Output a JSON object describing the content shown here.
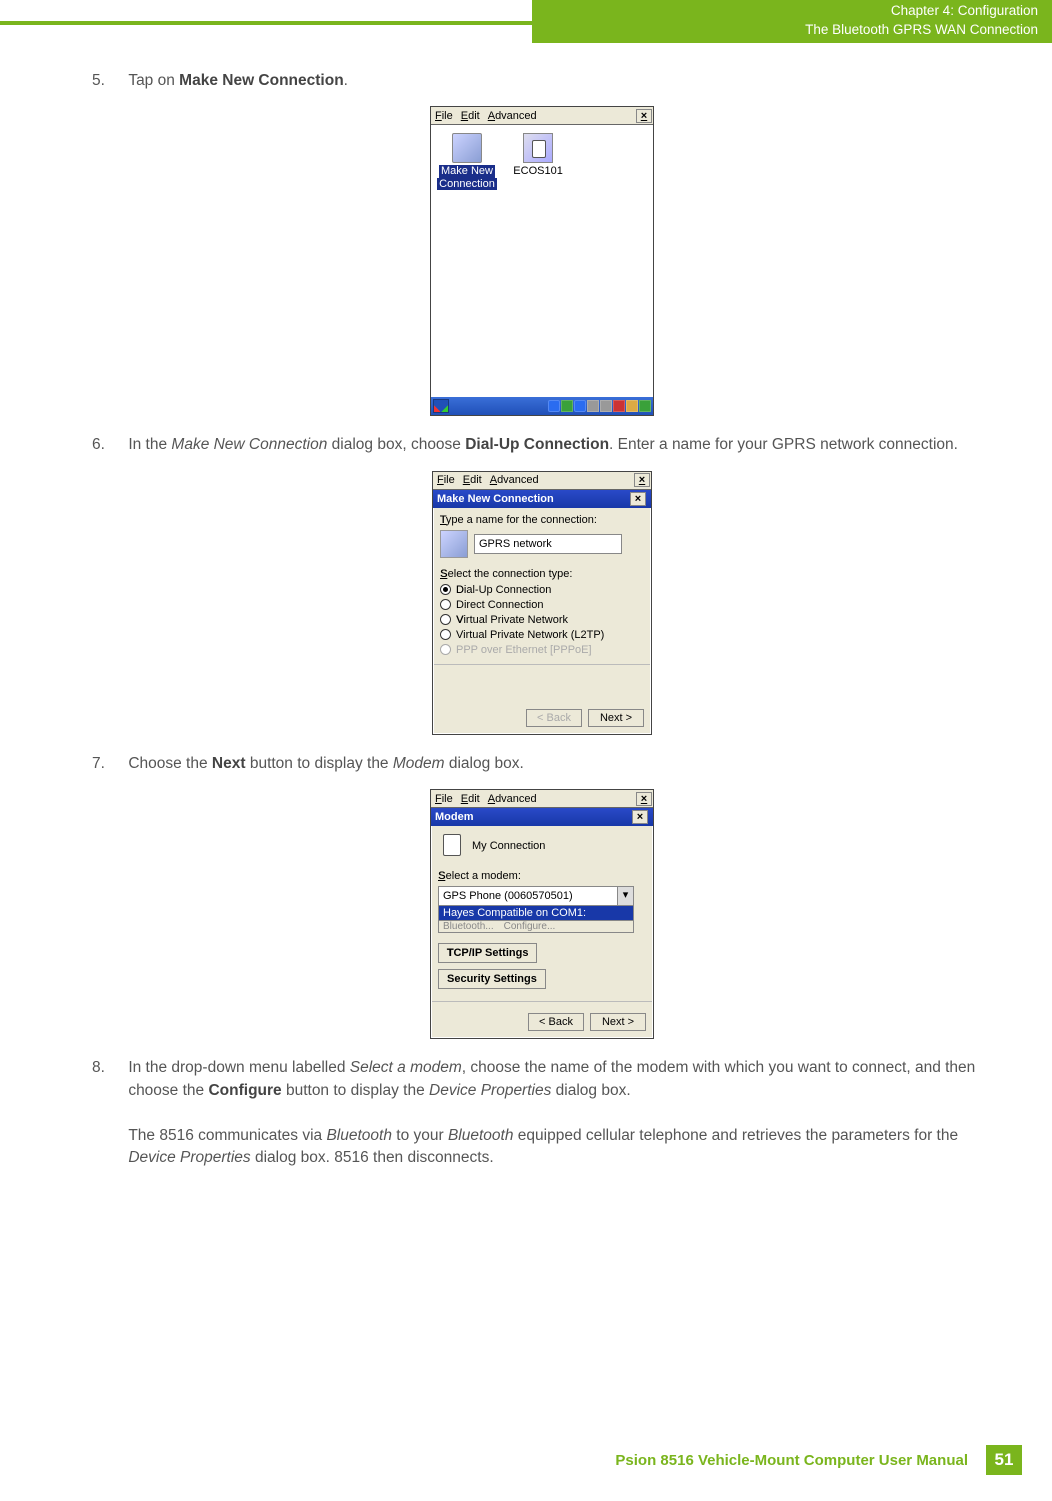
{
  "header": {
    "line1": "Chapter 4:  Configuration",
    "line2": "The Bluetooth GPRS WAN Connection"
  },
  "steps": {
    "s5": {
      "num": "5.",
      "text_a": "Tap on ",
      "bold": "Make New Connection",
      "text_b": "."
    },
    "s6": {
      "num": "6.",
      "text_a": "In the ",
      "italic1": "Make New Connection",
      "text_b": " dialog box, choose ",
      "bold": "Dial-Up Connection",
      "text_c": ". Enter a name for your GPRS network connection."
    },
    "s7": {
      "num": "7.",
      "text_a": "Choose the ",
      "bold": "Next",
      "text_b": " button to display the ",
      "italic1": "Modem",
      "text_c": " dialog box."
    },
    "s8": {
      "num": "8.",
      "text_a": "In the drop-down menu labelled ",
      "italic1": "Select a modem",
      "text_b": ", choose the name of the modem with which you want to connect, and then choose the ",
      "bold": "Configure",
      "text_c": " button to display the ",
      "italic2": "Device Properties",
      "text_d": " dialog box.",
      "para2_a": "The 8516 communicates via ",
      "para2_i1": "Bluetooth",
      "para2_b": " to your ",
      "para2_i2": "Bluetooth",
      "para2_c": " equipped cellular telephone and retrieves the parameters for the ",
      "para2_i3": "Device Properties",
      "para2_d": " dialog box. 8516 then disconnects."
    }
  },
  "ss1": {
    "menu_file": "File",
    "menu_edit": "Edit",
    "menu_adv": "Advanced",
    "icon1_line1": "Make New",
    "icon1_line2": "Connection",
    "icon2_label": "ECOS101"
  },
  "ss2": {
    "menu_file": "File",
    "menu_edit": "Edit",
    "menu_adv": "Advanced",
    "title": "Make New Connection",
    "label_type": "Type a name for the connection:",
    "input_value": "GPRS network",
    "label_select": "Select the connection type:",
    "r1": "Dial-Up Connection",
    "r2": "Direct Connection",
    "r3": "Virtual Private Network",
    "r4": "Virtual Private Network (L2TP)",
    "r5": "PPP over Ethernet [PPPoE]",
    "btn_back": "< Back",
    "btn_next": "Next >"
  },
  "ss3": {
    "menu_file": "File",
    "menu_edit": "Edit",
    "menu_adv": "Advanced",
    "title": "Modem",
    "conn_name": "My Connection",
    "label_select": "Select a modem:",
    "select_value": "GPS Phone (0060570501)",
    "dropdown_item": "Hayes Compatible on COM1:",
    "hidden1": "Bluetooth...",
    "hidden2": "Configure...",
    "btn_tcp": "TCP/IP Settings",
    "btn_sec": "Security Settings",
    "btn_back": "< Back",
    "btn_next": "Next >"
  },
  "footer": {
    "text": "Psion 8516 Vehicle-Mount Computer User Manual",
    "page": "51"
  }
}
